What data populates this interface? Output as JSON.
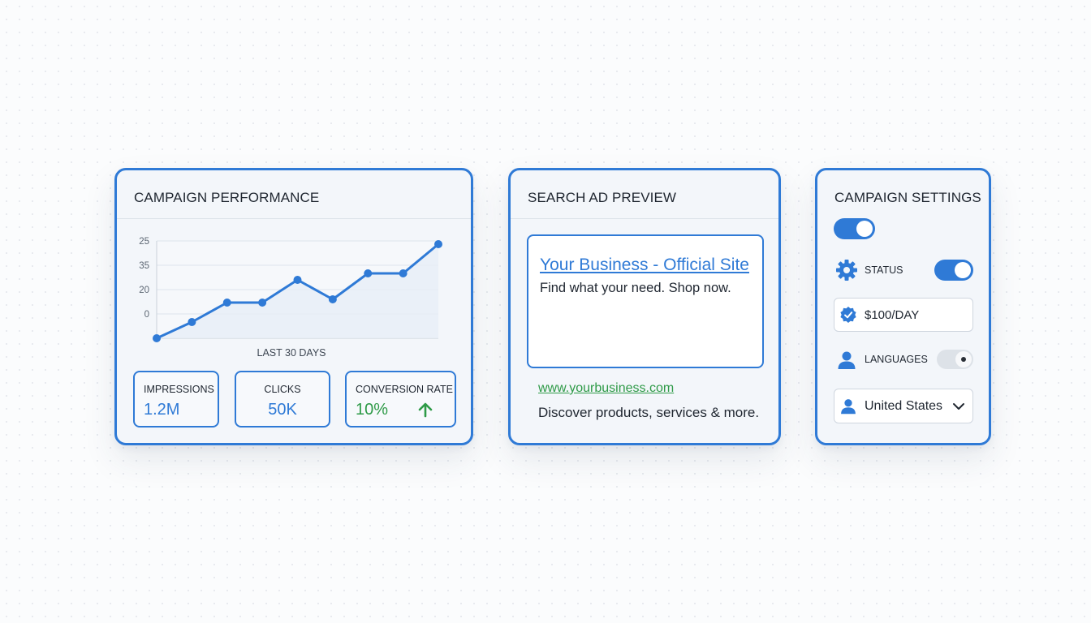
{
  "colors": {
    "accent": "#2f7ad6",
    "success": "#2e9a47",
    "text": "#1f2630",
    "card_bg": "#f3f6fa"
  },
  "performance": {
    "title": "CAMPAIGN PERFORMANCE",
    "chart_data": {
      "type": "line",
      "x": [
        1,
        2,
        3,
        4,
        5,
        6,
        7,
        8,
        9
      ],
      "values": [
        0,
        5,
        11,
        11,
        18,
        12,
        20,
        20,
        29
      ],
      "y_tick_labels": [
        "25",
        "35",
        "20",
        "0"
      ],
      "xlabel": "LAST 30 DAYS",
      "ylim": [
        0,
        30
      ],
      "grid": true,
      "legend": "none"
    },
    "stats": [
      {
        "label": "IMPRESSIONS",
        "value": "1.2M"
      },
      {
        "label": "CLICKS",
        "value": "50K"
      },
      {
        "label": "CONVERSION RATE",
        "value": "10%",
        "trend_icon": "arrow-up-icon"
      }
    ]
  },
  "ad_preview": {
    "title": "SEARCH AD PREVIEW",
    "headline": "Your Business - Official Site",
    "description": "Find what your need. Shop now.",
    "url": "www.yourbusiness.com",
    "tagline": "Discover products, services & more."
  },
  "settings": {
    "title": "CAMPAIGN SETTINGS",
    "master_toggle_on": true,
    "status_label": "STATUS",
    "status_icon": "gear-icon",
    "status_on": true,
    "budget_icon": "badge-check-icon",
    "budget_value": "$100/DAY",
    "languages_label": "LANGUAGES",
    "languages_icon": "person-icon",
    "languages_on": false,
    "location_icon": "person-icon",
    "location_value": "United States"
  }
}
